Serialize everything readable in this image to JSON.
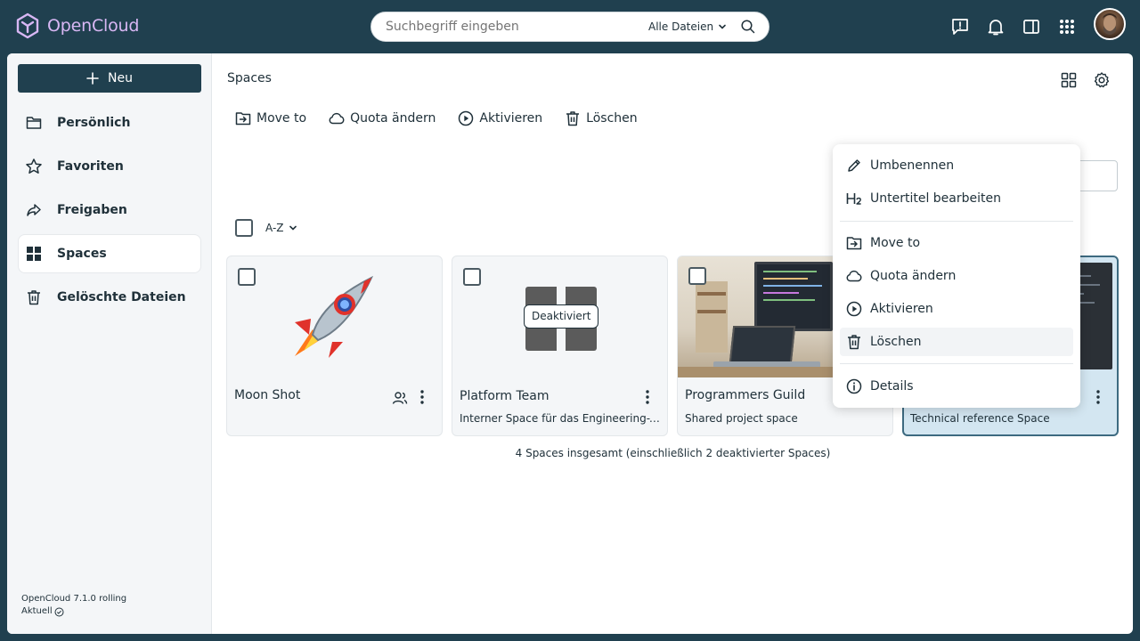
{
  "app": {
    "name": "OpenCloud",
    "brand_color": "#d8b7f4",
    "accent": "#20404f"
  },
  "search": {
    "placeholder": "Suchbegriff eingeben",
    "filter_label": "Alle Dateien"
  },
  "sidebar": {
    "new_label": "Neu",
    "items": [
      {
        "label": "Persönlich",
        "icon": "folder-icon"
      },
      {
        "label": "Favoriten",
        "icon": "star-icon"
      },
      {
        "label": "Freigaben",
        "icon": "share-icon"
      },
      {
        "label": "Spaces",
        "icon": "spaces-grid-icon",
        "active": true
      },
      {
        "label": "Gelöschte Dateien",
        "icon": "trash-icon"
      }
    ],
    "version": "OpenCloud 7.1.0 rolling",
    "status": "Aktuell"
  },
  "main": {
    "title": "Spaces",
    "toolbar": [
      {
        "label": "Move to",
        "icon": "move-icon"
      },
      {
        "label": "Quota ändern",
        "icon": "cloud-icon"
      },
      {
        "label": "Aktivieren",
        "icon": "play-icon"
      },
      {
        "label": "Löschen",
        "icon": "trash-icon"
      }
    ],
    "sort_label": "A-Z",
    "cards": [
      {
        "title": "Moon Shot",
        "subtitle": "",
        "badge": ""
      },
      {
        "title": "Platform Team",
        "subtitle": "Interner Space für das Engineering-Team",
        "badge": "Deaktiviert"
      },
      {
        "title": "Programmers Guild",
        "subtitle": "Shared project space",
        "badge": ""
      },
      {
        "title": "",
        "subtitle": "Technical reference Space",
        "badge": ""
      }
    ],
    "summary": "4 Spaces insgesamt (einschließlich 2 deaktivierter Spaces)"
  },
  "context_menu": {
    "items": [
      {
        "label": "Umbenennen",
        "icon": "pencil-icon"
      },
      {
        "label": "Untertitel bearbeiten",
        "icon": "heading-h2-icon"
      },
      {
        "label": "Move to",
        "icon": "move-icon"
      },
      {
        "label": "Quota ändern",
        "icon": "cloud-icon"
      },
      {
        "label": "Aktivieren",
        "icon": "play-icon"
      },
      {
        "label": "Löschen",
        "icon": "trash-icon"
      },
      {
        "label": "Details",
        "icon": "info-icon"
      }
    ]
  }
}
